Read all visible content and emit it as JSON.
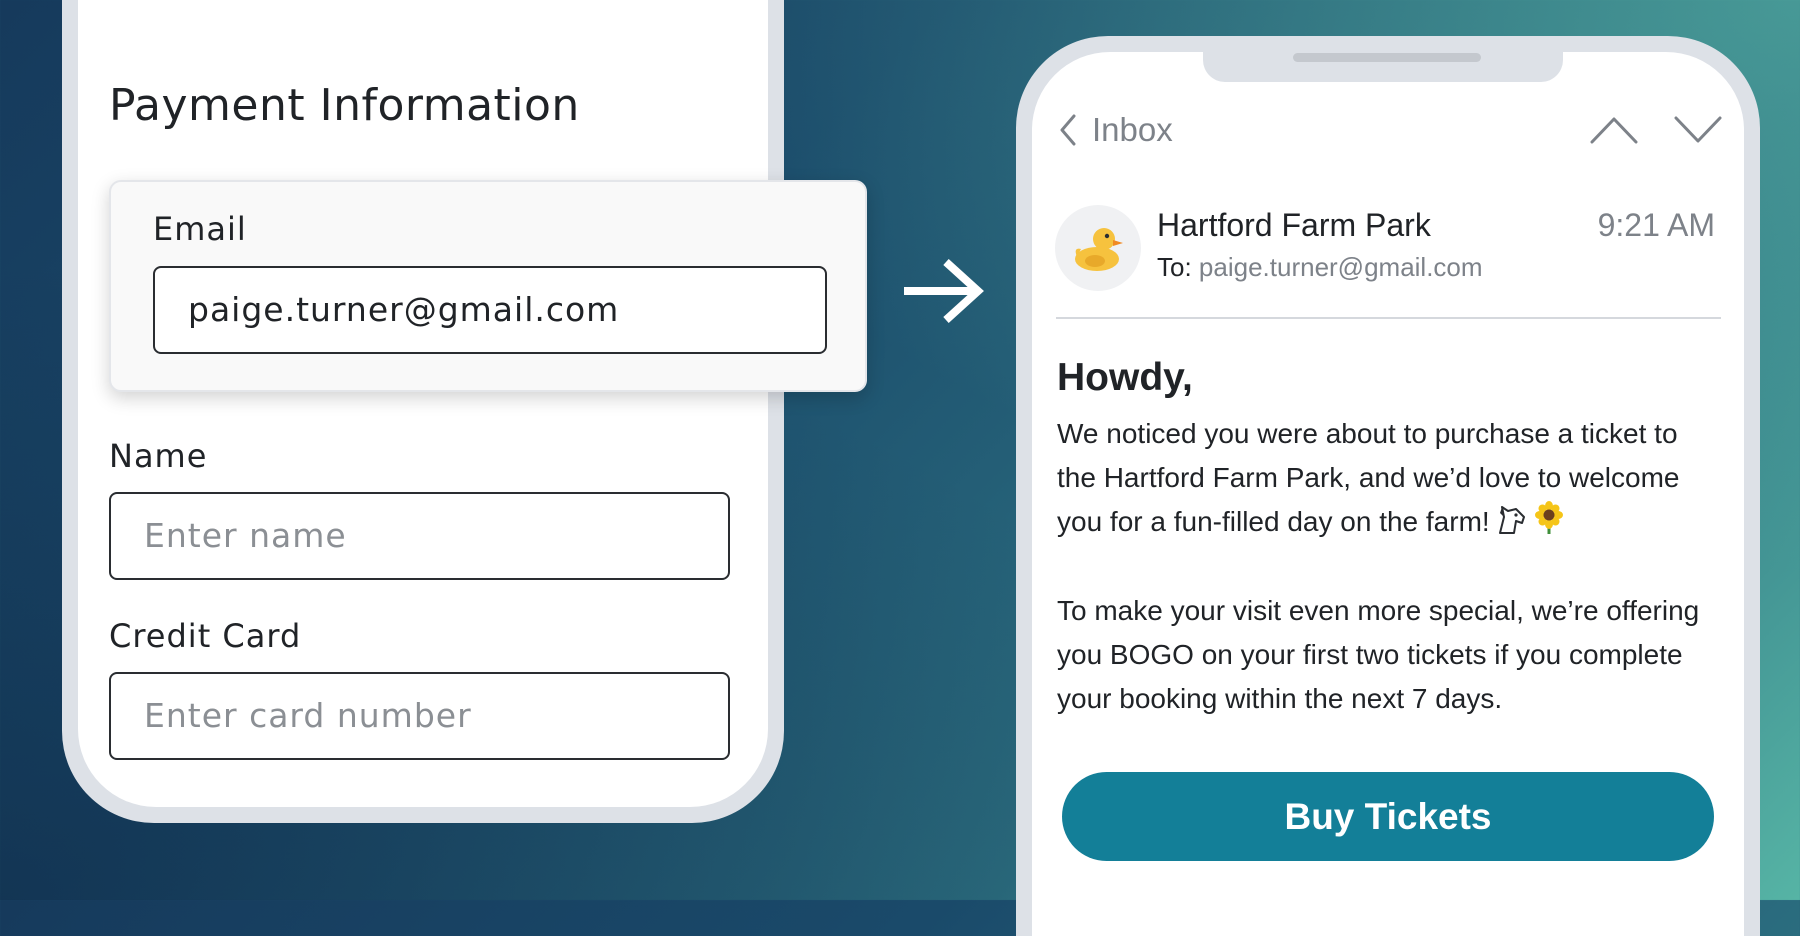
{
  "payment_form": {
    "title": "Payment Information",
    "email": {
      "label": "Email",
      "value": "paige.turner@gmail.com"
    },
    "name": {
      "label": "Name",
      "placeholder": "Enter name"
    },
    "credit_card": {
      "label": "Credit Card",
      "placeholder": "Enter card number"
    }
  },
  "email_view": {
    "back_label": "Inbox",
    "sender": "Hartford Farm Park",
    "time": "9:21 AM",
    "to_prefix": "To:",
    "to_address": "paige.turner@gmail.com",
    "greeting": "Howdy,",
    "paragraph1": "We noticed you were about to purchase a ticket to the Hartford Farm Park, and we’d love to welcome you for a fun-filled day on the farm!",
    "paragraph2": "To make your visit even more special, we’re offering you BOGO on your first two tickets if you complete your booking within the next 7 days.",
    "cta_label": "Buy Tickets",
    "avatar_icon": "duck-icon",
    "paragraph1_emojis": [
      "horse-icon",
      "sunflower-icon"
    ]
  },
  "colors": {
    "cta_background": "#137f98",
    "background_start": "#163a5c",
    "background_end": "#56b4a5"
  }
}
